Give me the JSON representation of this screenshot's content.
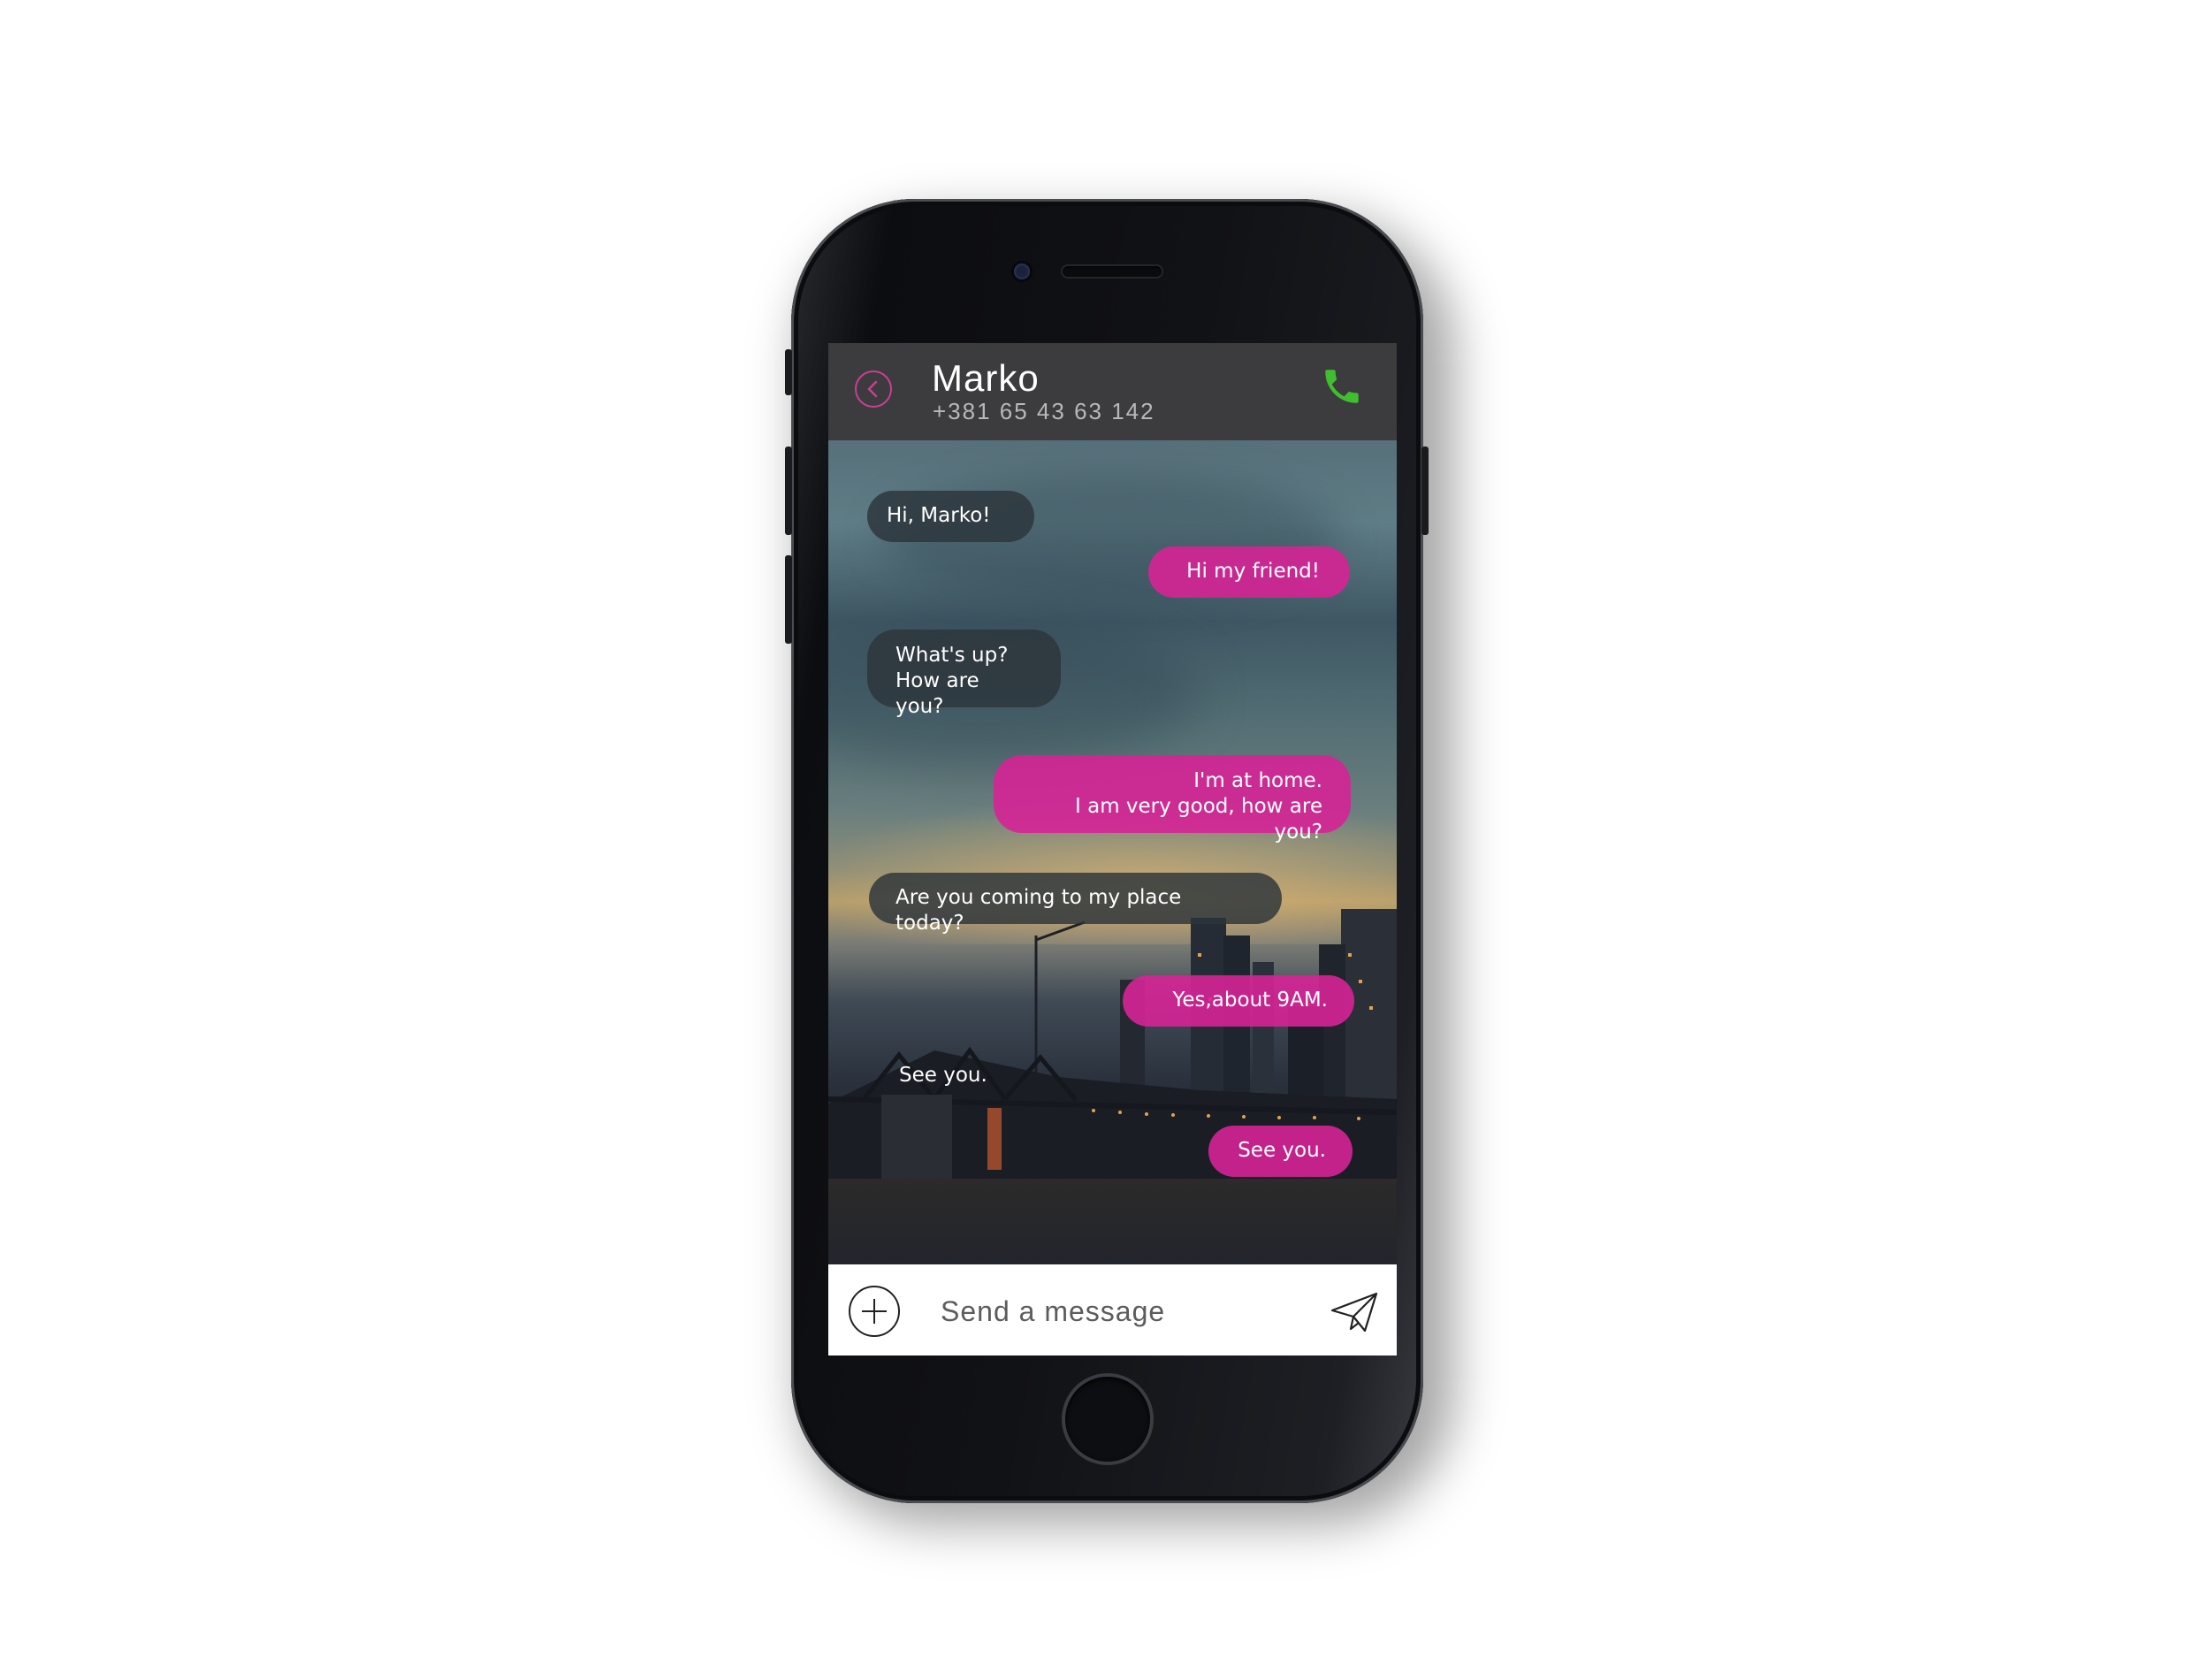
{
  "header": {
    "contact_name": "Marko",
    "contact_phone": "+381 65 43 63 142"
  },
  "messages": [
    {
      "direction": "incoming",
      "text": "Hi, Marko!"
    },
    {
      "direction": "outgoing",
      "text": "Hi my friend!"
    },
    {
      "direction": "incoming",
      "text": "What's up?\nHow are you?"
    },
    {
      "direction": "outgoing",
      "text": "I'm at home.\nI am very good, how are you?"
    },
    {
      "direction": "incoming",
      "text": "Are you coming to my place today?"
    },
    {
      "direction": "outgoing",
      "text": "Yes,about 9AM."
    },
    {
      "direction": "incoming",
      "text": "See you."
    },
    {
      "direction": "outgoing",
      "text": "See you."
    }
  ],
  "composer": {
    "placeholder": "Send a message"
  },
  "colors": {
    "accent": "#d62496",
    "call_green": "#3fbf2f",
    "header_bg": "#3c3c3e",
    "incoming_bubble": "#2c343a"
  },
  "icons": {
    "back": "chevron-left-circle",
    "call": "phone-handset",
    "attach": "plus-circle",
    "send": "paper-plane"
  }
}
